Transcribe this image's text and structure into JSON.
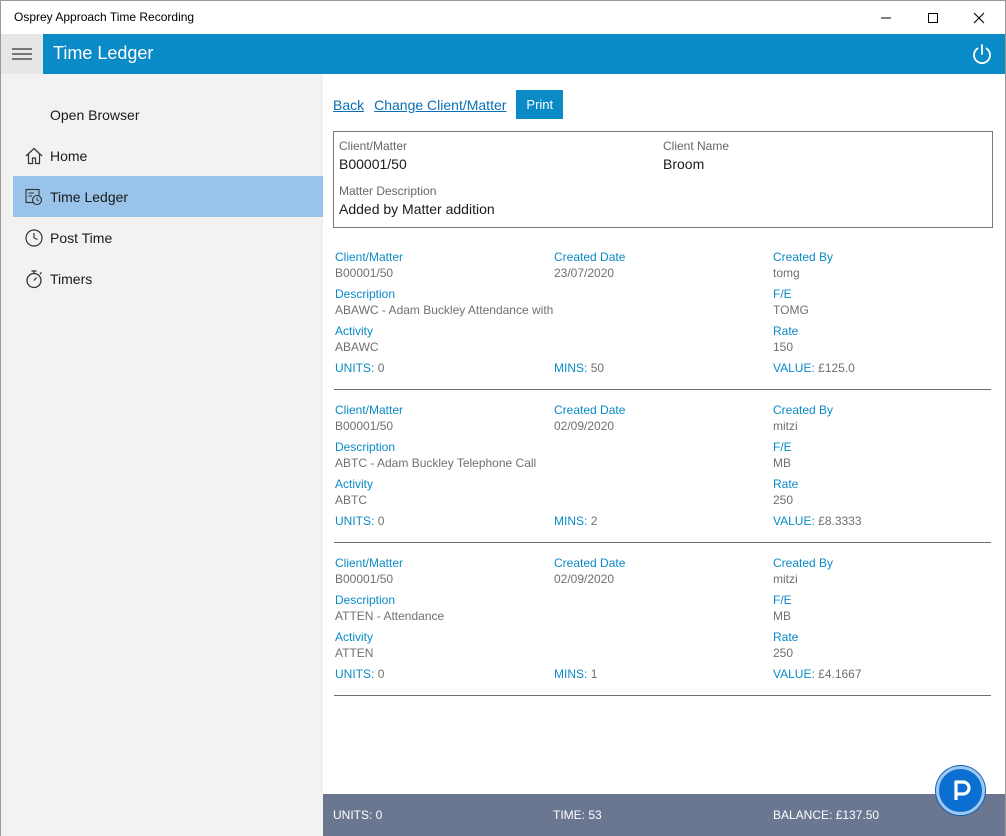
{
  "window": {
    "title": "Osprey Approach Time Recording"
  },
  "header": {
    "title": "Time Ledger"
  },
  "sidebar": {
    "items": [
      {
        "label": "Open Browser"
      },
      {
        "label": "Home"
      },
      {
        "label": "Time Ledger"
      },
      {
        "label": "Post Time"
      },
      {
        "label": "Timers"
      }
    ]
  },
  "toolbar": {
    "back": "Back",
    "change": "Change Client/Matter",
    "print": "Print"
  },
  "info": {
    "client_matter_label": "Client/Matter",
    "client_matter_value": "B00001/50",
    "client_name_label": "Client Name",
    "client_name_value": "Broom",
    "matter_description_label": "Matter Description",
    "matter_description_value": "Added by Matter addition"
  },
  "labels": {
    "client_matter": "Client/Matter",
    "created_date": "Created Date",
    "created_by": "Created By",
    "description": "Description",
    "fe": "F/E",
    "activity": "Activity",
    "rate": "Rate",
    "units": "UNITS:",
    "mins": "MINS:",
    "value": "VALUE:"
  },
  "entries": [
    {
      "client_matter": "B00001/50",
      "created_date": "23/07/2020",
      "created_by": "tomg",
      "description": "ABAWC - Adam Buckley Attendance with",
      "fe": "TOMG",
      "activity": "ABAWC",
      "rate": "150",
      "units": "0",
      "mins": "50",
      "value": "£125.0"
    },
    {
      "client_matter": "B00001/50",
      "created_date": "02/09/2020",
      "created_by": "mitzi",
      "description": "ABTC - Adam Buckley Telephone Call",
      "fe": "MB",
      "activity": "ABTC",
      "rate": "250",
      "units": "0",
      "mins": "2",
      "value": "£8.3333"
    },
    {
      "client_matter": "B00001/50",
      "created_date": "02/09/2020",
      "created_by": "mitzi",
      "description": "ATTEN - Attendance",
      "fe": "MB",
      "activity": "ATTEN",
      "rate": "250",
      "units": "0",
      "mins": "1",
      "value": "£4.1667"
    }
  ],
  "footer": {
    "units": "UNITS: 0",
    "time": "TIME: 53",
    "balance": "BALANCE: £137.50"
  },
  "colors": {
    "accent": "#0a8ac6",
    "selected": "#99c3e8",
    "footer": "#6b7790"
  },
  "icons": [
    "hamburger-icon",
    "power-icon",
    "home-icon",
    "ledger-icon",
    "clock-icon",
    "stopwatch-icon",
    "osprey-p-icon"
  ]
}
